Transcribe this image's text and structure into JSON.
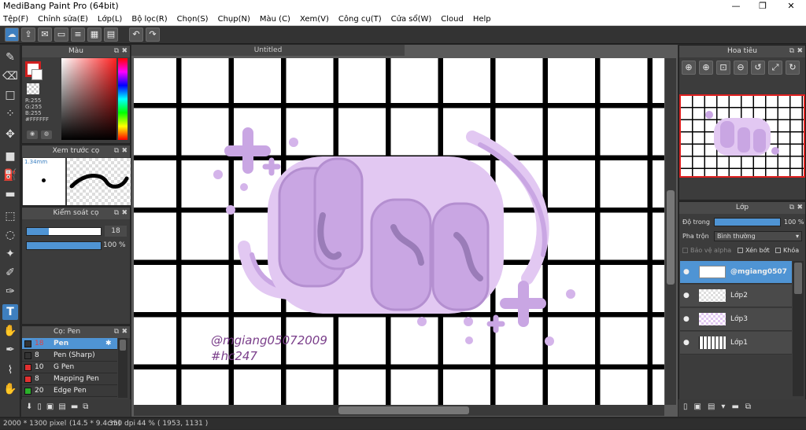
{
  "window": {
    "title": "MediBang Paint Pro (64bit)",
    "minimize": "—",
    "maximize": "❐",
    "close": "✕"
  },
  "menu": [
    "Tệp(F)",
    "Chỉnh sửa(E)",
    "Lớp(L)",
    "Bộ lọc(R)",
    "Chọn(S)",
    "Chụp(N)",
    "Màu (C)",
    "Xem(V)",
    "Công cụ(T)",
    "Cửa sổ(W)",
    "Cloud",
    "Help"
  ],
  "color_panel": {
    "title": "Màu",
    "r": "R:255",
    "g": "G:255",
    "b": "B:255",
    "hex": "#FFFFFF"
  },
  "brush_preview": {
    "title": "Xem trước cọ",
    "size": "1.34mm"
  },
  "brush_control": {
    "title": "Kiểm soát cọ",
    "size_value": "18",
    "opacity_value": "100 %",
    "size_fraction": 0.3,
    "opacity_fraction": 1.0
  },
  "brush_list": {
    "title": "Cọ: Pen",
    "items": [
      {
        "size": "18",
        "name": "Pen",
        "color": "#333333",
        "selected": true
      },
      {
        "size": "8",
        "name": "Pen (Sharp)",
        "color": "#333333",
        "selected": false
      },
      {
        "size": "10",
        "name": "G Pen",
        "color": "#e03030",
        "selected": false
      },
      {
        "size": "8",
        "name": "Mapping Pen",
        "color": "#e03030",
        "selected": false
      },
      {
        "size": "20",
        "name": "Edge Pen",
        "color": "#2ab02a",
        "selected": false
      }
    ]
  },
  "canvas": {
    "tab_label": "Untitled",
    "watermark_line1": "@mgiang05072009",
    "watermark_line2": "#hc247"
  },
  "navigator": {
    "title": "Hoa tiêu"
  },
  "layers": {
    "title": "Lớp",
    "opacity_label": "Độ trong",
    "opacity_value": "100 %",
    "blend_label": "Pha trộn",
    "blend_value": "Bình thường",
    "protect_alpha": "Bảo vệ alpha",
    "clipping": "Xén bớt",
    "lock": "Khóa",
    "items": [
      {
        "name": "@mgiang0507",
        "selected": true
      },
      {
        "name": "Lớp2",
        "selected": false
      },
      {
        "name": "Lớp3",
        "selected": false
      },
      {
        "name": "Lớp1",
        "selected": false
      }
    ]
  },
  "status": {
    "pixel": "2000 * 1300 pixel",
    "size": "(14.5 * 9.4cm)",
    "dpi": "350 dpi",
    "zoom": "44 %",
    "coords": "( 1953, 1131 )"
  },
  "colors": {
    "accent": "#4f94d4",
    "panel": "#3c3c3c",
    "grid": "#000000",
    "bubble": "#c9a6e3",
    "bubble_dark": "#9a7cb8"
  }
}
